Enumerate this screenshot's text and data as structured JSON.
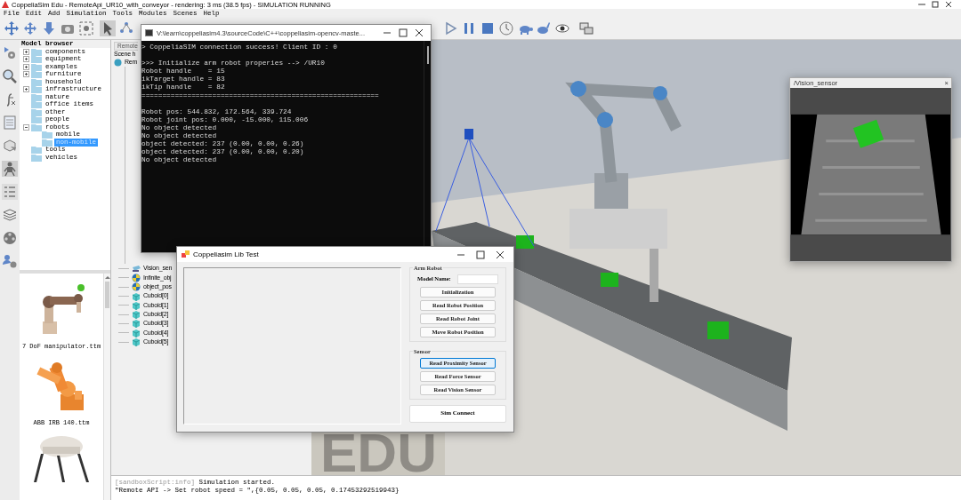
{
  "window": {
    "title": "CoppeliaSim Edu - RemoteApi_UR10_with_conveyor - rendering: 3 ms (38.5 fps) - SIMULATION RUNNING"
  },
  "menu": [
    "File",
    "Edit",
    "Add",
    "Simulation",
    "Tools",
    "Modules",
    "Scenes",
    "Help"
  ],
  "model_browser": {
    "title": "Model browser",
    "items": [
      {
        "label": "components",
        "kind": "collapsed",
        "selected": false
      },
      {
        "label": "equipment",
        "kind": "collapsed",
        "selected": false
      },
      {
        "label": "examples",
        "kind": "collapsed",
        "selected": false
      },
      {
        "label": "furniture",
        "kind": "collapsed",
        "selected": false
      },
      {
        "label": "household",
        "kind": "leaf",
        "selected": false
      },
      {
        "label": "infrastructure",
        "kind": "collapsed",
        "selected": false
      },
      {
        "label": "nature",
        "kind": "leaf",
        "selected": false
      },
      {
        "label": "office items",
        "kind": "leaf",
        "selected": false
      },
      {
        "label": "other",
        "kind": "leaf",
        "selected": false
      },
      {
        "label": "people",
        "kind": "leaf",
        "selected": false
      },
      {
        "label": "robots",
        "kind": "expanded",
        "selected": false,
        "children": [
          {
            "label": "mobile",
            "kind": "leaf",
            "selected": false
          },
          {
            "label": "non-mobile",
            "kind": "leaf",
            "selected": true
          }
        ]
      },
      {
        "label": "tools",
        "kind": "leaf",
        "selected": false
      },
      {
        "label": "vehicles",
        "kind": "leaf",
        "selected": false
      }
    ],
    "thumbnails": [
      {
        "kind": "arm",
        "label": "7 DoF manipulator.ttm"
      },
      {
        "kind": "industrial",
        "label": "ABB IRB 140.ttm"
      },
      {
        "kind": "delta"
      }
    ]
  },
  "scene_hierarchy": {
    "tab": "Remote",
    "title": "Scene h",
    "root": "Rem",
    "items": [
      {
        "label": "Vision_sen",
        "kind": "sensor"
      },
      {
        "label": "Infinite_obj",
        "kind": "dummy"
      },
      {
        "label": "object_pos",
        "kind": "dummy"
      },
      {
        "label": "Cuboid[0]",
        "kind": "shape"
      },
      {
        "label": "Cuboid[1]",
        "kind": "shape"
      },
      {
        "label": "Cuboid[2]",
        "kind": "shape"
      },
      {
        "label": "Cuboid[3]",
        "kind": "shape"
      },
      {
        "label": "Cuboid[4]",
        "kind": "shape"
      },
      {
        "label": "Cuboid[5]",
        "kind": "shape"
      }
    ]
  },
  "viewport": {
    "logo": "EDU"
  },
  "vision_sensor": {
    "title": "/Vision_sensor",
    "close": "×"
  },
  "console_window": {
    "title": "V:\\learn\\coppeliasim4.3\\sourceCode\\C++\\coppeliasim-opencv-maste...",
    "lines": [
      {
        "kind": "text",
        "text": "> CoppeliaSIM connection success! Client ID : 0"
      },
      {
        "kind": "blank"
      },
      {
        "kind": "text",
        "text": ">>> Initialize arm robot properies --> /UR10"
      },
      {
        "kind": "text",
        "text": "Robot handle    = 15"
      },
      {
        "kind": "text",
        "text": "ikTarget handle = 83"
      },
      {
        "kind": "text",
        "text": "ikTip handle    = 82"
      },
      {
        "kind": "text",
        "text": "========================================================="
      },
      {
        "kind": "blank"
      },
      {
        "kind": "text",
        "text": "Robot pos: 544.832, 172.564, 339.724"
      },
      {
        "kind": "text",
        "text": "Robot joint pos: 0.000, -15.000, 115.006"
      },
      {
        "kind": "text",
        "text": "No object detected"
      },
      {
        "kind": "text",
        "text": "No object detected"
      },
      {
        "kind": "text",
        "text": "object detected: 237 (0.00, 0.00, 0.26)"
      },
      {
        "kind": "text",
        "text": "object detected: 237 (0.00, 0.00, 0.20)"
      },
      {
        "kind": "text",
        "text": "No object detected"
      }
    ]
  },
  "dialog": {
    "title": "Coppeliasim Lib Test",
    "arm_group": {
      "title": "Arm Robot",
      "model_label": "Model Name:",
      "buttons": [
        {
          "label": "Initialization",
          "hovered": false
        },
        {
          "label": "Read Robot Position",
          "hovered": false
        },
        {
          "label": "Read Robot Joint",
          "hovered": false
        },
        {
          "label": "Move Robot Position",
          "hovered": false
        }
      ]
    },
    "sensor_group": {
      "title": "Sensor",
      "buttons": [
        {
          "label": "Read Proximity Sensor",
          "hovered": true
        },
        {
          "label": "Read Force Sensor",
          "hovered": false
        },
        {
          "label": "Read Vision Sensor",
          "hovered": false
        }
      ]
    },
    "connect_button": "Sim Connect"
  },
  "console": {
    "lines": [
      {
        "source": "[sandboxScript:info]",
        "text": "Simulation started."
      },
      {
        "text": "\"Remote API -> Set robot speed = \",{0.05, 0.05, 0.05, 0.17453292519943}"
      }
    ]
  }
}
